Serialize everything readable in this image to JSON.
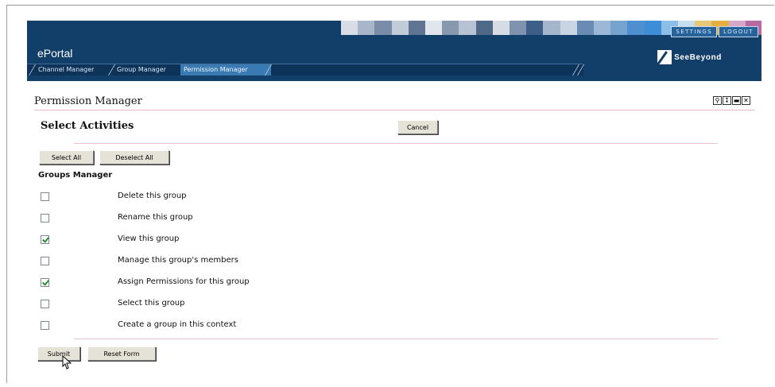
{
  "header": {
    "brand": "ePortal",
    "top_links": [
      "SETTINGS",
      "LOGOUT"
    ],
    "tabs": [
      {
        "label": "Channel Manager",
        "active": false
      },
      {
        "label": "Group Manager",
        "active": false
      },
      {
        "label": "Permission Manager",
        "active": true
      }
    ],
    "logo_text": "SeeBeyond",
    "strip_colors": [
      "#d9dde6",
      "#a9b6c9",
      "#7a8ca8",
      "#c2ccd9",
      "#5f7592",
      "#e1e5ec",
      "#8898af",
      "#b7c3d3",
      "#4e6886",
      "#d7dce4",
      "#7f93ae",
      "#3d5e86",
      "#a4b6cb",
      "#c9d5e3",
      "#6b8cb2",
      "#9cb8d6",
      "#77a3cf",
      "#4e90cf",
      "#3d8ed6",
      "#8cbee8",
      "#c8dff0",
      "#e6c87a",
      "#e5b040",
      "#d6a6c6",
      "#b86aa2"
    ]
  },
  "page": {
    "title": "Permission Manager",
    "window_icons": [
      "search-icon",
      "download-icon",
      "restore-icon",
      "close-icon"
    ]
  },
  "section": {
    "title": "Select Activities",
    "cancel_label": "Cancel",
    "select_all_label": "Select All",
    "deselect_all_label": "Deselect All",
    "group_title": "Groups Manager",
    "permissions": [
      {
        "label": "Delete this group",
        "checked": false
      },
      {
        "label": "Rename this group",
        "checked": false
      },
      {
        "label": "View this group",
        "checked": true
      },
      {
        "label": "Manage this group's members",
        "checked": false
      },
      {
        "label": "Assign Permissions for this group",
        "checked": true
      },
      {
        "label": "Select this group",
        "checked": false
      },
      {
        "label": "Create a group in this context",
        "checked": false
      }
    ],
    "submit_label": "Submit",
    "reset_label": "Reset Form"
  }
}
